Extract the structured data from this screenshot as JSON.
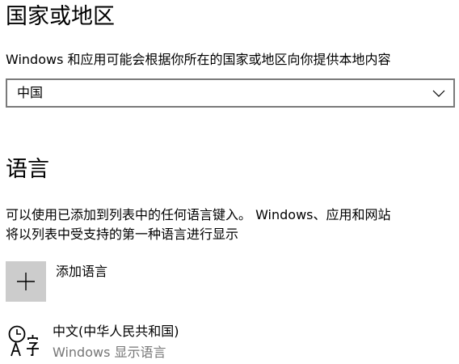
{
  "region": {
    "title": "国家或地区",
    "description": "Windows 和应用可能会根据你所在的国家或地区向你提供本地内容",
    "dropdown": {
      "selected": "中国",
      "icon": "chevron-down-icon"
    }
  },
  "language": {
    "title": "语言",
    "description_lines": [
      "可以使用已添加到列表中的任何语言键入。 Windows、应用和网站",
      "将以列表中受支持的第一种语言进行显示"
    ],
    "add_button": {
      "icon": "plus-icon",
      "label": "添加语言"
    },
    "items": [
      {
        "icon": "language-icon",
        "name": "中文(中华人民共和国)",
        "subtitle": "Windows 显示语言"
      }
    ]
  }
}
